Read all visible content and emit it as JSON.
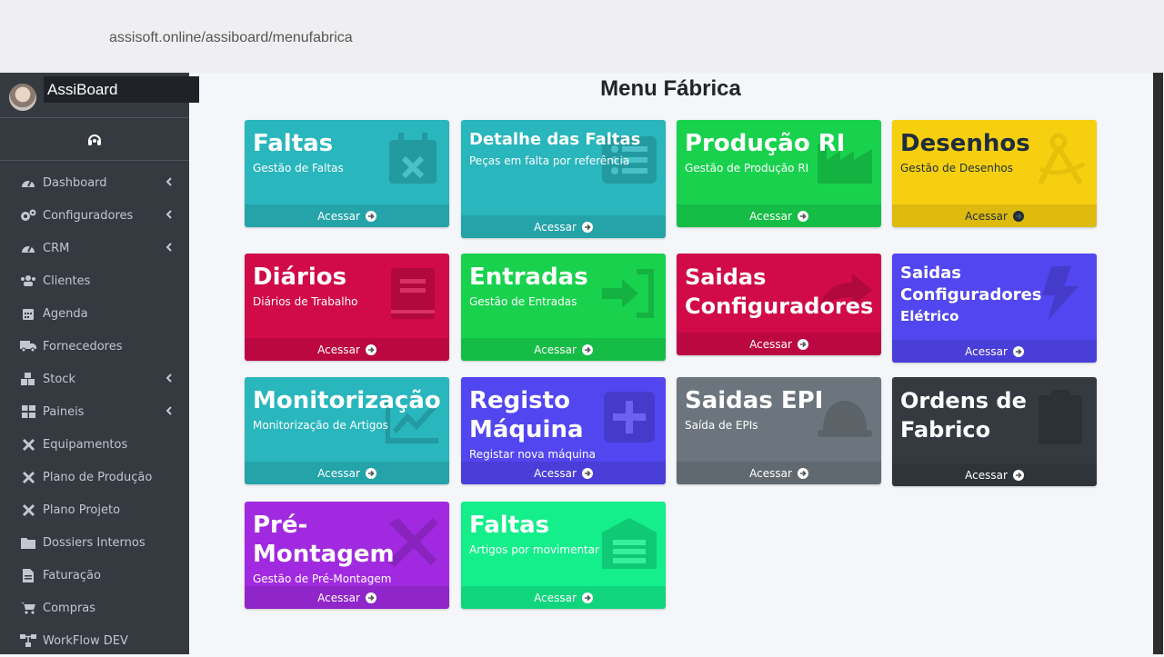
{
  "browser": {
    "url": "assisoft.online/assiboard/menufabrica"
  },
  "brand": {
    "name": "AssiBoard"
  },
  "sidebar": {
    "items": [
      {
        "label": "Dashboard",
        "icon": "tachometer-icon",
        "chevron": true
      },
      {
        "label": "Configuradores",
        "icon": "cogs-icon",
        "chevron": true
      },
      {
        "label": "CRM",
        "icon": "tachometer-icon",
        "chevron": true
      },
      {
        "label": "Clientes",
        "icon": "users-icon",
        "chevron": false
      },
      {
        "label": "Agenda",
        "icon": "calendar-icon",
        "chevron": false
      },
      {
        "label": "Fornecedores",
        "icon": "truck-icon",
        "chevron": false
      },
      {
        "label": "Stock",
        "icon": "boxes-icon",
        "chevron": true
      },
      {
        "label": "Paineis",
        "icon": "grid-icon",
        "chevron": true
      },
      {
        "label": "Equipamentos",
        "icon": "tools-icon",
        "chevron": false
      },
      {
        "label": "Plano de Produção",
        "icon": "tools-icon",
        "chevron": false
      },
      {
        "label": "Plano Projeto",
        "icon": "tools-icon",
        "chevron": false
      },
      {
        "label": "Dossiers Internos",
        "icon": "folder-icon",
        "chevron": false
      },
      {
        "label": "Faturação",
        "icon": "invoice-icon",
        "chevron": false
      },
      {
        "label": "Compras",
        "icon": "cart-icon",
        "chevron": false
      },
      {
        "label": "WorkFlow DEV",
        "icon": "sitemap-icon",
        "chevron": false
      }
    ]
  },
  "main": {
    "title": "Menu Fábrica",
    "footer_label": "Acessar",
    "cards": [
      {
        "title": "Faltas",
        "subtitle": "Gestão de Faltas",
        "color": "#29b6bd",
        "icon": "calendar-times-icon"
      },
      {
        "title": "Detalhe das Faltas",
        "subtitle": "Peças em falta por referência",
        "color": "#29b6bd",
        "icon": "list-icon"
      },
      {
        "title": "Produção RI",
        "subtitle": "Gestão de Produção RI",
        "color": "#18d24d",
        "icon": "industry-icon"
      },
      {
        "title": "Desenhos",
        "subtitle": "Gestão de Desenhos",
        "color": "#f6d00f",
        "icon": "compass-icon"
      },
      {
        "title": "Diários",
        "subtitle": "Diários de Trabalho",
        "color": "#d10a4a",
        "icon": "book-icon"
      },
      {
        "title": "Entradas",
        "subtitle": "Gestão de Entradas",
        "color": "#18d24d",
        "icon": "sign-in-icon"
      },
      {
        "title": "Saidas Configuradores",
        "subtitle": "",
        "color": "#d10a4a",
        "icon": "share-icon"
      },
      {
        "title": "Saidas Configuradores",
        "subtitle": "Elétrico",
        "color": "#5246f0",
        "icon": "bolt-icon"
      },
      {
        "title": "Monitorização",
        "subtitle": "Monitorização de Artigos",
        "color": "#29b6bd",
        "icon": "chart-icon"
      },
      {
        "title": "Registo Máquina",
        "subtitle": "Registar nova máquina",
        "color": "#5246f0",
        "icon": "plus-square-icon"
      },
      {
        "title": "Saidas EPI",
        "subtitle": "Saída de EPIs",
        "color": "#6c757d",
        "icon": "hard-hat-icon"
      },
      {
        "title": "Ordens de Fabrico",
        "subtitle": "",
        "color": "#343a40",
        "icon": "clipboard-icon"
      },
      {
        "title": "Pré-Montagem",
        "subtitle": "Gestão de Pré-Montagem",
        "color": "#a12ae0",
        "icon": "tools-icon"
      },
      {
        "title": "Faltas",
        "subtitle": "Artigos por movimentar",
        "color": "#14ee8b",
        "icon": "warehouse-icon"
      }
    ]
  }
}
